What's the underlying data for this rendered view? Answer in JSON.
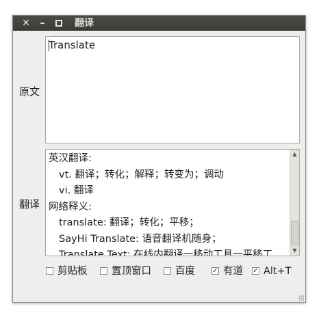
{
  "window": {
    "title": "翻译",
    "close_glyph": "✕",
    "minimize_glyph": "–"
  },
  "source": {
    "label": "原文",
    "text": "Translate"
  },
  "translation": {
    "label": "翻译",
    "lines": [
      {
        "text": "英汉翻译:",
        "indent": false
      },
      {
        "text": "vt. 翻译；转化；解释；转变为；调动",
        "indent": true
      },
      {
        "text": "vi. 翻译",
        "indent": true
      },
      {
        "text": "网络释义:",
        "indent": false
      },
      {
        "text": "translate: 翻译；转化；平移；",
        "indent": true
      },
      {
        "text": "SayHi Translate: 语音翻译机随身；",
        "indent": true
      },
      {
        "text": "Translate Text: 在线内翻译一移动工具一平移工",
        "indent": true
      }
    ]
  },
  "options": [
    {
      "label": "剪贴板",
      "checked": false
    },
    {
      "label": "置顶窗口",
      "checked": false
    },
    {
      "label": "百度",
      "checked": false
    },
    {
      "label": "有道",
      "checked": true
    },
    {
      "label": "Alt+T",
      "checked": true
    }
  ]
}
